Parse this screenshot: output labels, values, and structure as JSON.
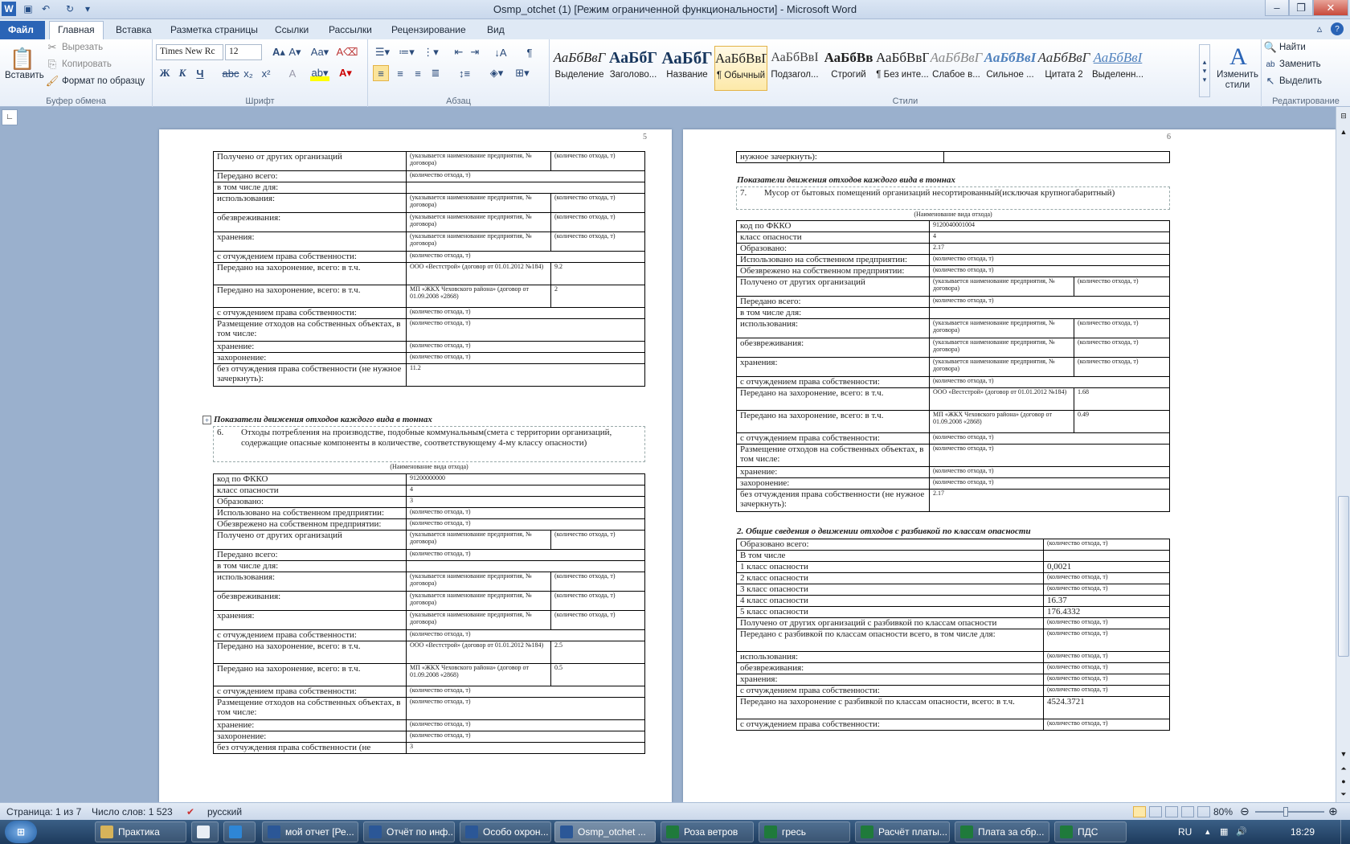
{
  "window": {
    "title": "Osmp_otchet (1) [Режим ограниченной функциональности]  -  Microsoft Word"
  },
  "tabs": [
    "Файл",
    "Главная",
    "Вставка",
    "Разметка страницы",
    "Ссылки",
    "Рассылки",
    "Рецензирование",
    "Вид"
  ],
  "ribbon": {
    "clipboard": {
      "paste": "Вставить",
      "cut": "Вырезать",
      "copy": "Копировать",
      "format": "Формат по образцу",
      "label": "Буфер обмена"
    },
    "font": {
      "name": "Times New Rc",
      "size": "12",
      "label": "Шрифт"
    },
    "paragraph": {
      "label": "Абзац"
    },
    "styles": {
      "label": "Стили",
      "items": [
        {
          "preview": "АаБбВвГ",
          "name": "Выделение"
        },
        {
          "preview": "АаБбГ",
          "name": "Заголово..."
        },
        {
          "preview": "АаБбГ",
          "name": "Название"
        },
        {
          "preview": "АаБбВвГ",
          "name": "¶ Обычный"
        },
        {
          "preview": "АаБбВвІ",
          "name": "Подзагол..."
        },
        {
          "preview": "АаБбВв",
          "name": "Строгий"
        },
        {
          "preview": "АаБбВвГ",
          "name": "¶ Без инте..."
        },
        {
          "preview": "АаБбВвГ",
          "name": "Слабое в..."
        },
        {
          "preview": "АаБбВвІ",
          "name": "Сильное ..."
        },
        {
          "preview": "АаБбВвГ",
          "name": "Цитата 2"
        },
        {
          "preview": "АаБбВвІ",
          "name": "Выделенн..."
        }
      ],
      "change": "Изменить стили"
    },
    "editing": {
      "find": "Найти",
      "replace": "Заменить",
      "select": "Выделить",
      "label": "Редактирование"
    }
  },
  "doc": {
    "q": "(количество отхода, т)",
    "org": "(указывается наименование предприятия, № договора)",
    "page5": {
      "num": "5",
      "top_rows": [
        "Получено от других организаций",
        "Передано всего:",
        "в том числе для:",
        "использования:",
        "обезвреживания:",
        "хранения:",
        "с отчуждением права собственности:",
        "Передано на захоронение, всего: в т.ч.",
        "Передано на захоронение, всего: в т.ч.",
        "с отчуждением права собственности:",
        "Размещение отходов на собственных объектах, в том числе:",
        "хранение:",
        "захоронение:",
        "без отчуждения права собственности (не нужное зачеркнуть):"
      ],
      "contract1": "ООО «Вестстрой» (договор от 01.01.2012 №184)",
      "contract2": "МП «ЖКХ Чеховского района» (договор от 01.09.2008 «2868)",
      "v_top1": "9.2",
      "v_top2": "2",
      "v_top3": "11.2",
      "heading": "Показатели движения отходов каждого вида в тоннах",
      "item_no": "6.",
      "item_text": "Отходы потребления на производстве, подобные коммунальным(смета с территории организаций, содержащие опасные компоненты в количестве, соответствующему 4-му классу опасности)",
      "caption": "(Наименование вида отхода)",
      "b_rows": [
        "код по ФККО",
        "класс опасности",
        "Образовано:",
        "Использовано на собственном предприятии:",
        "Обезврежено на собственном предприятии:",
        "Получено от других организаций",
        "Передано всего:",
        "в том числе для:",
        "использования:",
        "обезвреживания:",
        "хранения:",
        "с отчуждением права собственности:",
        "Передано на захоронение, всего: в т.ч.",
        "Передано на захоронение, всего: в т.ч.",
        "с отчуждением права собственности:",
        "Размещение отходов на собственных объектах, в том числе:",
        "хранение:",
        "захоронение:",
        "без отчуждения права собственности (не"
      ],
      "b_fkko": "91200000000",
      "b_class": "4",
      "b_formed": "3",
      "b_v1": "2.5",
      "b_v2": "0.5",
      "b_last": "3"
    },
    "page6": {
      "num": "6",
      "top_row": "нужное зачеркнуть):",
      "heading": "Показатели движения отходов каждого вида в тоннах",
      "item_no": "7.",
      "item_text": "Мусор от бытовых помещений организаций несортированный(исключая крупногабаритный)",
      "caption": "(Наименование вида отхода)",
      "fkko": "9120040001004",
      "class": "4",
      "formed": "2.17",
      "v1": "1.68",
      "v2": "0.49",
      "last": "2.17",
      "heading2": "2. Общие сведения о движении отходов с разбивкой по классам опасности",
      "sum_rows": [
        {
          "l": "Образовано всего:",
          "v": "(количество отхода, т)"
        },
        {
          "l": "В том числе",
          "v": ""
        },
        {
          "l": "1 класс опасности",
          "v": "0,0021"
        },
        {
          "l": "2 класс опасности",
          "v": "(количество отхода, т)"
        },
        {
          "l": "3 класс опасности",
          "v": "(количество отхода, т)"
        },
        {
          "l": "4 класс опасности",
          "v": "16.37"
        },
        {
          "l": "5 класс опасности",
          "v": "176.4332"
        },
        {
          "l": "Получено от других организаций с разбивкой по классам опасности",
          "v": "(количество отхода, т)"
        },
        {
          "l": "Передано с разбивкой по классам опасности всего, в том числе для:",
          "v": "(количество отхода, т)"
        },
        {
          "l": "использования:",
          "v": "(количество отхода, т)"
        },
        {
          "l": "обезвреживания:",
          "v": "(количество отхода, т)"
        },
        {
          "l": "хранения:",
          "v": "(количество отхода, т)"
        },
        {
          "l": "с отчуждением права собственности:",
          "v": "(количество отхода, т)"
        },
        {
          "l": "Передано на захоронение с разбивкой по классам опасности, всего: в т.ч.",
          "v": "4524.3721"
        },
        {
          "l": "с отчуждением права собственности:",
          "v": "(количество отхода, т)"
        }
      ]
    }
  },
  "status": {
    "page": "Страница: 1 из 7",
    "words": "Число слов: 1 523",
    "lang": "русский",
    "zoom": "80%"
  },
  "taskbar": {
    "items": [
      "Практика",
      "",
      "",
      "мой отчет [Ре...",
      "Отчёт по инф...",
      "Особо охрон...",
      "Osmp_otchet ...",
      "Роза ветров",
      "гресь",
      "Расчёт платы...",
      "Плата за сбр...",
      "ПДС"
    ],
    "lang": "RU",
    "time": "18:29"
  }
}
